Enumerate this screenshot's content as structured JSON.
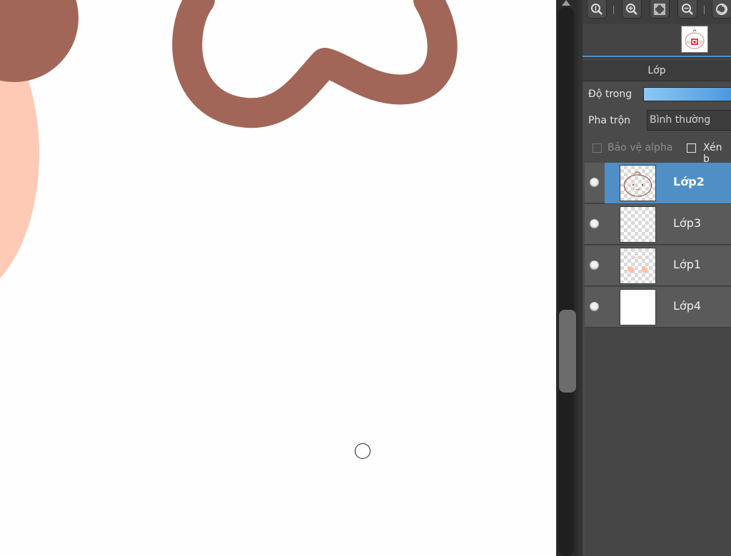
{
  "panel": {
    "section_title": "Lớp",
    "opacity_label": "Độ trong",
    "blend_label": "Pha trộn",
    "blend_value": "Bình thường",
    "protect_alpha_label": "Bảo vệ alpha",
    "clipping_label": "Xén b"
  },
  "layers": [
    {
      "name": "Lớp2",
      "selected": true
    },
    {
      "name": "Lớp3",
      "selected": false
    },
    {
      "name": "Lớp1",
      "selected": false
    },
    {
      "name": "Lớp4",
      "selected": false
    }
  ],
  "toolbar": {
    "icons": [
      "zoom-actual-icon",
      "zoom-in-icon",
      "fit-screen-icon",
      "zoom-out-icon",
      "rotate-icon"
    ]
  },
  "colors": {
    "stroke_brown": "#a26658",
    "skin": "#ffcab5",
    "selection_blue": "#4f8fc6",
    "panel_bg": "#4a4a4a"
  }
}
